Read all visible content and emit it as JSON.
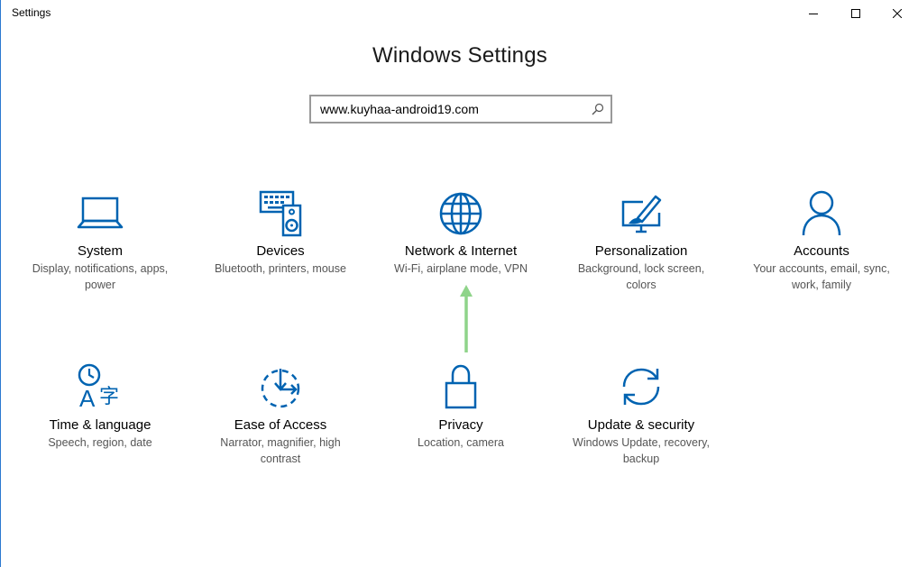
{
  "window": {
    "title": "Settings",
    "accent_color": "#0063b1",
    "controls": [
      "minimize-icon",
      "maximize-icon",
      "close-icon"
    ]
  },
  "heading": "Windows Settings",
  "search": {
    "value": "www.kuyhaa-android19.com",
    "icon": "search-icon"
  },
  "tiles": [
    {
      "name": "System",
      "description": "Display, notifications, apps, power",
      "icon": "laptop-icon"
    },
    {
      "name": "Devices",
      "description": "Bluetooth, printers, mouse",
      "icon": "keyboard-speaker-icon"
    },
    {
      "name": "Network & Internet",
      "description": "Wi-Fi, airplane mode, VPN",
      "icon": "globe-icon"
    },
    {
      "name": "Personalization",
      "description": "Background, lock screen, colors",
      "icon": "paint-screen-icon"
    },
    {
      "name": "Accounts",
      "description": "Your accounts, email, sync, work, family",
      "icon": "person-icon"
    },
    {
      "name": "Time & language",
      "description": "Speech, region, date",
      "icon": "clock-language-icon"
    },
    {
      "name": "Ease of Access",
      "description": "Narrator, magnifier, high contrast",
      "icon": "ease-of-access-icon"
    },
    {
      "name": "Privacy",
      "description": "Location, camera",
      "icon": "lock-icon"
    },
    {
      "name": "Update & security",
      "description": "Windows Update, recovery, backup",
      "icon": "sync-arrows-icon"
    }
  ],
  "annotation": {
    "icon": "green-arrow-icon",
    "color": "#8fd48a"
  }
}
